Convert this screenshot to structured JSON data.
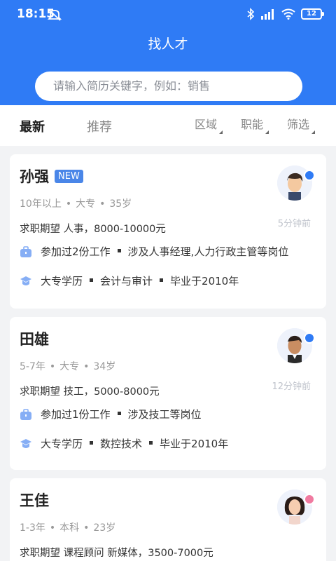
{
  "status": {
    "time": "18:15",
    "battery": "12"
  },
  "header": {
    "title": "找人才"
  },
  "search": {
    "placeholder": "请输入简历关键字，例如：销售"
  },
  "tabs": {
    "latest": "最新",
    "recommend": "推荐",
    "filters": [
      "区域",
      "职能",
      "筛选"
    ]
  },
  "cards": [
    {
      "name": "孙强",
      "badge": "NEW",
      "meta": [
        "10年以上",
        "大专",
        "35岁"
      ],
      "expect": "求职期望 人事，8000-10000元",
      "time": "5分钟前",
      "work": [
        "参加过2份工作",
        "涉及人事经理,人力行政主管等岗位"
      ],
      "edu": [
        "大专学历",
        "会计与审计",
        "毕业于2010年"
      ],
      "gender": "male"
    },
    {
      "name": "田雄",
      "meta": [
        "5-7年",
        "大专",
        "34岁"
      ],
      "expect": "求职期望 技工，5000-8000元",
      "time": "12分钟前",
      "work": [
        "参加过1份工作",
        "涉及技工等岗位"
      ],
      "edu": [
        "大专学历",
        "数控技术",
        "毕业于2010年"
      ],
      "gender": "male"
    },
    {
      "name": "王佳",
      "meta": [
        "1-3年",
        "本科",
        "23岁"
      ],
      "expect": "求职期望 课程顾问 新媒体，3500-7000元",
      "gender": "female"
    }
  ],
  "colors": {
    "brand": "#2f7bf5",
    "male": "#2f7bf5",
    "female": "#f07aa0"
  }
}
